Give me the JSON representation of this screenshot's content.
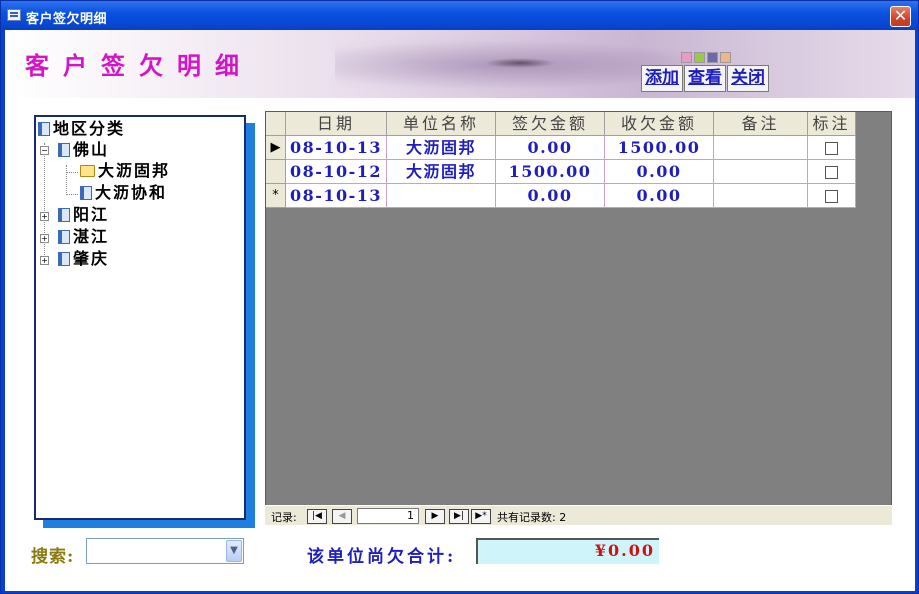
{
  "window": {
    "title": "客户签欠明细",
    "close_label": "✕"
  },
  "banner": {
    "title": "客户签欠明细",
    "swatch_colors": [
      "#e89ac8",
      "#9cc84a",
      "#6a6aa8",
      "#f0b48a"
    ],
    "buttons": {
      "add": "添加",
      "view": "查看",
      "close": "关闭"
    }
  },
  "tree": {
    "root": "地区分类",
    "regions": [
      {
        "name": "佛山",
        "expanded": true,
        "children": [
          "大沥固邦",
          "大沥协和"
        ]
      },
      {
        "name": "阳江",
        "expanded": false
      },
      {
        "name": "湛江",
        "expanded": false
      },
      {
        "name": "肇庆",
        "expanded": false
      }
    ]
  },
  "grid": {
    "columns": [
      "日期",
      "单位名称",
      "签欠金额",
      "收欠金额",
      "备注",
      "标注"
    ],
    "rows": [
      {
        "selector": "▶",
        "date": "08-10-13",
        "unit": "大沥固邦",
        "owed": "0.00",
        "received": "1500.00",
        "note": "",
        "flag": false
      },
      {
        "selector": "",
        "date": "08-10-12",
        "unit": "大沥固邦",
        "owed": "1500.00",
        "received": "0.00",
        "note": "",
        "flag": false
      },
      {
        "selector": "*",
        "date": "08-10-13",
        "unit": "",
        "owed": "0.00",
        "received": "0.00",
        "note": "",
        "flag": false
      }
    ]
  },
  "navigator": {
    "record_label": "记录:",
    "current": "1",
    "total_label": "共有记录数: 2"
  },
  "search": {
    "label": "搜索:",
    "value": ""
  },
  "total": {
    "label": "该单位尚欠合计:",
    "value": "¥0.00"
  }
}
